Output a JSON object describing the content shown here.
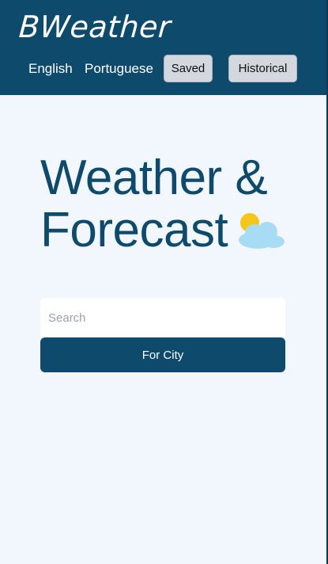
{
  "header": {
    "logo": "BWeather",
    "nav": {
      "english": "English",
      "portuguese": "Portuguese",
      "saved": "Saved",
      "historical": "Historical"
    }
  },
  "main": {
    "title_line1": "Weather &",
    "title_line2": "Forecast",
    "title_icon": "sun-behind-cloud-icon",
    "search": {
      "placeholder": "Search",
      "value": ""
    },
    "search_button": "For City"
  },
  "colors": {
    "header_bg": "#0d4a6b",
    "page_bg": "#f2f7fd",
    "accent": "#0d4a6b",
    "nav_button_bg": "#d3d7de",
    "sun": "#f5c518",
    "cloud": "#a8dcf5"
  }
}
